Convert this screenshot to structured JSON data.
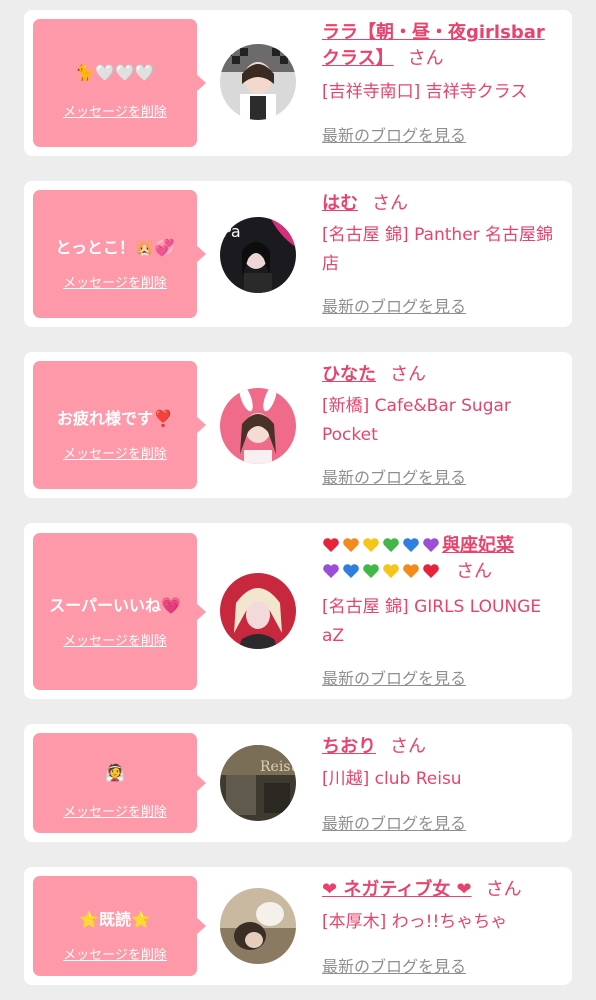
{
  "delete_label": "メッセージを削除",
  "blog_label": "最新のブログを見る",
  "honorific": "さん",
  "items": [
    {
      "message": "🐈🤍🤍🤍",
      "name": "ララ【朝・昼・夜girlsbarクラス】",
      "name_line1": "ララ【朝・昼・夜girlsbar",
      "name_line2": "クラス】",
      "shop": "[吉祥寺南口] 吉祥寺クラス",
      "avatar_icon": "profile-photo-maid"
    },
    {
      "message": "とっとこ！🐹💞",
      "name": "はむ",
      "shop": "[名古屋 錦] Panther 名古屋錦店",
      "avatar_icon": "profile-photo-dark"
    },
    {
      "message": "お疲れ様です❣️",
      "name": "ひなた",
      "shop": "[新橋] Cafe&Bar Sugar Pocket",
      "avatar_icon": "profile-photo-bunny"
    },
    {
      "message": "スーパーいいね💗",
      "name": "❤️🧡💛💚💙💜與座妃菜💜💙💚💛🧡❤️",
      "name_text": "與座妃菜",
      "hearts": [
        "#e8223a",
        "#f38a1c",
        "#f5c518",
        "#43b649",
        "#2f7fe0",
        "#9b4fd6"
      ],
      "shop": "[名古屋 錦] GIRLS LOUNGE aZ",
      "avatar_icon": "profile-photo-red"
    },
    {
      "message": "👰",
      "name": "ちおり",
      "shop": "[川越] club Reisu",
      "avatar_icon": "profile-photo-night"
    },
    {
      "message": "⭐既読⭐",
      "name": "❤ ネガティブ女 ❤",
      "shop": "[本厚木] わっ!!ちゃちゃ",
      "avatar_icon": "profile-photo-beige"
    }
  ]
}
